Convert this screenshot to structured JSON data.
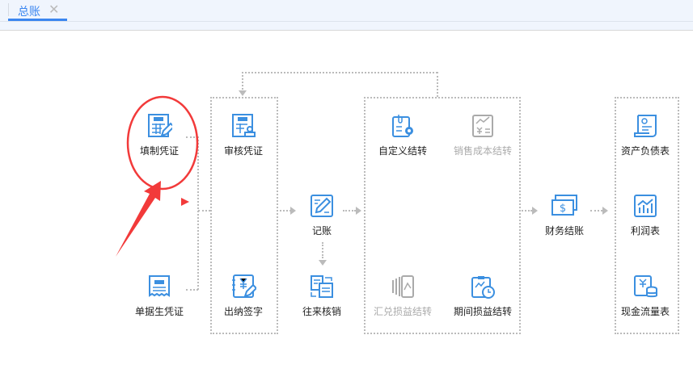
{
  "tabs": [
    {
      "label": "总账",
      "close_icon": "✕",
      "active": true
    }
  ],
  "colors": {
    "accent": "#3b86f0",
    "icon": "#3b8fe0",
    "disabled": "#aaaaaa",
    "annotation": "#f23a3a"
  },
  "nodes": {
    "fill_voucher": "填制凭证",
    "doc_voucher": "单据生凭证",
    "review_voucher": "审核凭证",
    "cashier_sign": "出纳签字",
    "posting": "记账",
    "writeoff": "往来核销",
    "custom_transfer": "自定义结转",
    "sales_cost_transfer": "销售成本结转",
    "fx_transfer": "汇兑损益结转",
    "period_transfer": "期间损益结转",
    "close_account": "财务结账",
    "balance_sheet": "资产负债表",
    "income_statement": "利润表",
    "cashflow_statement": "现金流量表"
  }
}
